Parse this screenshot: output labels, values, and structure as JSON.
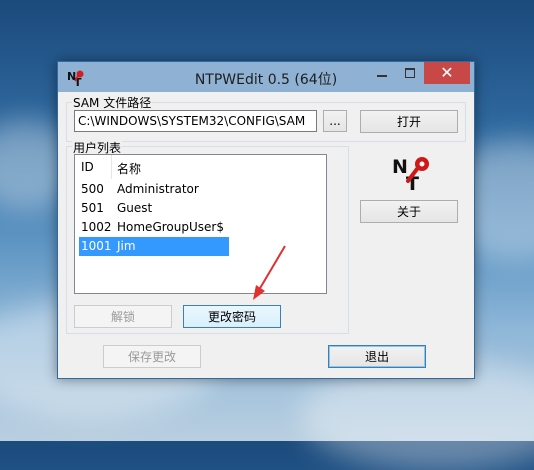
{
  "window": {
    "title": "NTPWEdit 0.5 (64位)"
  },
  "sam": {
    "group_label": "SAM 文件路径",
    "path_value": "C:\\WINDOWS\\SYSTEM32\\CONFIG\\SAM",
    "browse_label": "...",
    "open_label": "打开"
  },
  "users": {
    "group_label": "用户列表",
    "columns": [
      "ID",
      "名称"
    ],
    "rows": [
      {
        "id": "500",
        "name": "Administrator"
      },
      {
        "id": "501",
        "name": "Guest"
      },
      {
        "id": "1002",
        "name": "HomeGroupUser$"
      },
      {
        "id": "1001",
        "name": "Jim"
      }
    ],
    "selected_index": 3,
    "unlock_label": "解锁",
    "change_password_label": "更改密码"
  },
  "side": {
    "logo_letters": "NT",
    "about_label": "关于"
  },
  "footer": {
    "save_label": "保存更改",
    "exit_label": "退出"
  },
  "colors": {
    "selection": "#3399ff",
    "close_button": "#c84848",
    "annotation_arrow": "#e03030"
  }
}
